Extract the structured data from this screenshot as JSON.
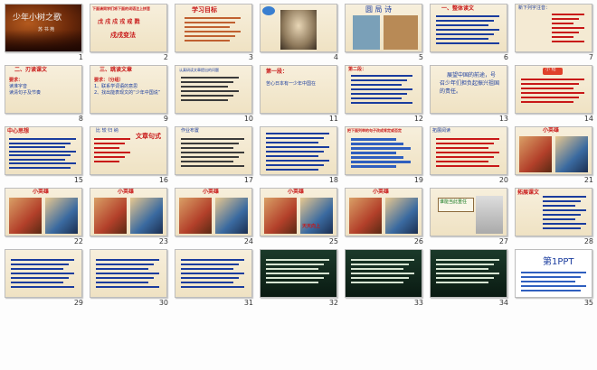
{
  "slides": [
    {
      "number": "1",
      "style": "title",
      "title_text": "少年小树之歌",
      "subtitle_text": "苏 书 苑"
    },
    {
      "number": "2",
      "style": "parch",
      "line1": "下面请同学们将下面的词语注上拼音",
      "line2": "戊 戌 戍 戎 戒 戮",
      "line3": "戍戌变法"
    },
    {
      "number": "3",
      "style": "parch",
      "heading": "学习目标"
    },
    {
      "number": "4",
      "style": "parch"
    },
    {
      "number": "5",
      "style": "parch",
      "heading": "圆 局 诗"
    },
    {
      "number": "6",
      "style": "parch",
      "heading": "一、整体读文"
    },
    {
      "number": "7",
      "style": "plain",
      "heading": "新下列字注音："
    },
    {
      "number": "8",
      "style": "parch",
      "heading": "二、刃读课文",
      "items": [
        "要求：",
        "读准字音",
        "读清句子及节奏"
      ]
    },
    {
      "number": "9",
      "style": "parch",
      "heading": "三、跳读文章",
      "items": [
        "要求：（分组）",
        "1、联系学词语的意思",
        "2、找出能表现文的“少年中国说”"
      ]
    },
    {
      "number": "10",
      "style": "parch",
      "heading": "认真研读文章提出的问题"
    },
    {
      "number": "11",
      "style": "parch",
      "heading": "第一段：",
      "line2": "苦心日本有一少年中国在"
    },
    {
      "number": "12",
      "style": "parch",
      "heading": "第二段："
    },
    {
      "number": "13",
      "style": "parch",
      "line1": "展望中国的前途，号",
      "line2": "召少年们担负起振兴祖国",
      "line3": "的责任。"
    },
    {
      "number": "14",
      "style": "parch",
      "heading": "小 结"
    },
    {
      "number": "15",
      "style": "parch",
      "heading": "中心思想"
    },
    {
      "number": "16",
      "style": "parch",
      "heading": "比 较 归 纳",
      "side": "文章句式"
    },
    {
      "number": "17",
      "style": "parch",
      "heading": "作业布置"
    },
    {
      "number": "18",
      "style": "parch"
    },
    {
      "number": "19",
      "style": "parch",
      "heading": "把下面列举的句子改成肯定或否定"
    },
    {
      "number": "20",
      "style": "parch",
      "heading": "拓展阅读"
    },
    {
      "number": "21",
      "style": "parch",
      "heading": "小英雄"
    },
    {
      "number": "22",
      "style": "parch",
      "heading": "小英雄"
    },
    {
      "number": "23",
      "style": "parch",
      "heading": "小英雄"
    },
    {
      "number": "24",
      "style": "parch",
      "heading": "小英雄"
    },
    {
      "number": "25",
      "style": "parch",
      "heading": "小英雄",
      "badge": "天天向上"
    },
    {
      "number": "26",
      "style": "parch",
      "heading": "小英雄"
    },
    {
      "number": "27",
      "style": "parch",
      "heading": "谁能当此重任"
    },
    {
      "number": "28",
      "style": "parch",
      "heading": "拓展课文"
    },
    {
      "number": "29",
      "style": "parch"
    },
    {
      "number": "30",
      "style": "parch"
    },
    {
      "number": "31",
      "style": "parch"
    },
    {
      "number": "32",
      "style": "dark"
    },
    {
      "number": "33",
      "style": "dark"
    },
    {
      "number": "34",
      "style": "dark"
    },
    {
      "number": "35",
      "style": "ppt",
      "logo_text": "第1PPT"
    }
  ],
  "colors": {
    "heading_red": "#c81818",
    "heading_green": "#157a20",
    "text_blue": "#1a3c9e",
    "link_blue": "#2f5fbf"
  }
}
